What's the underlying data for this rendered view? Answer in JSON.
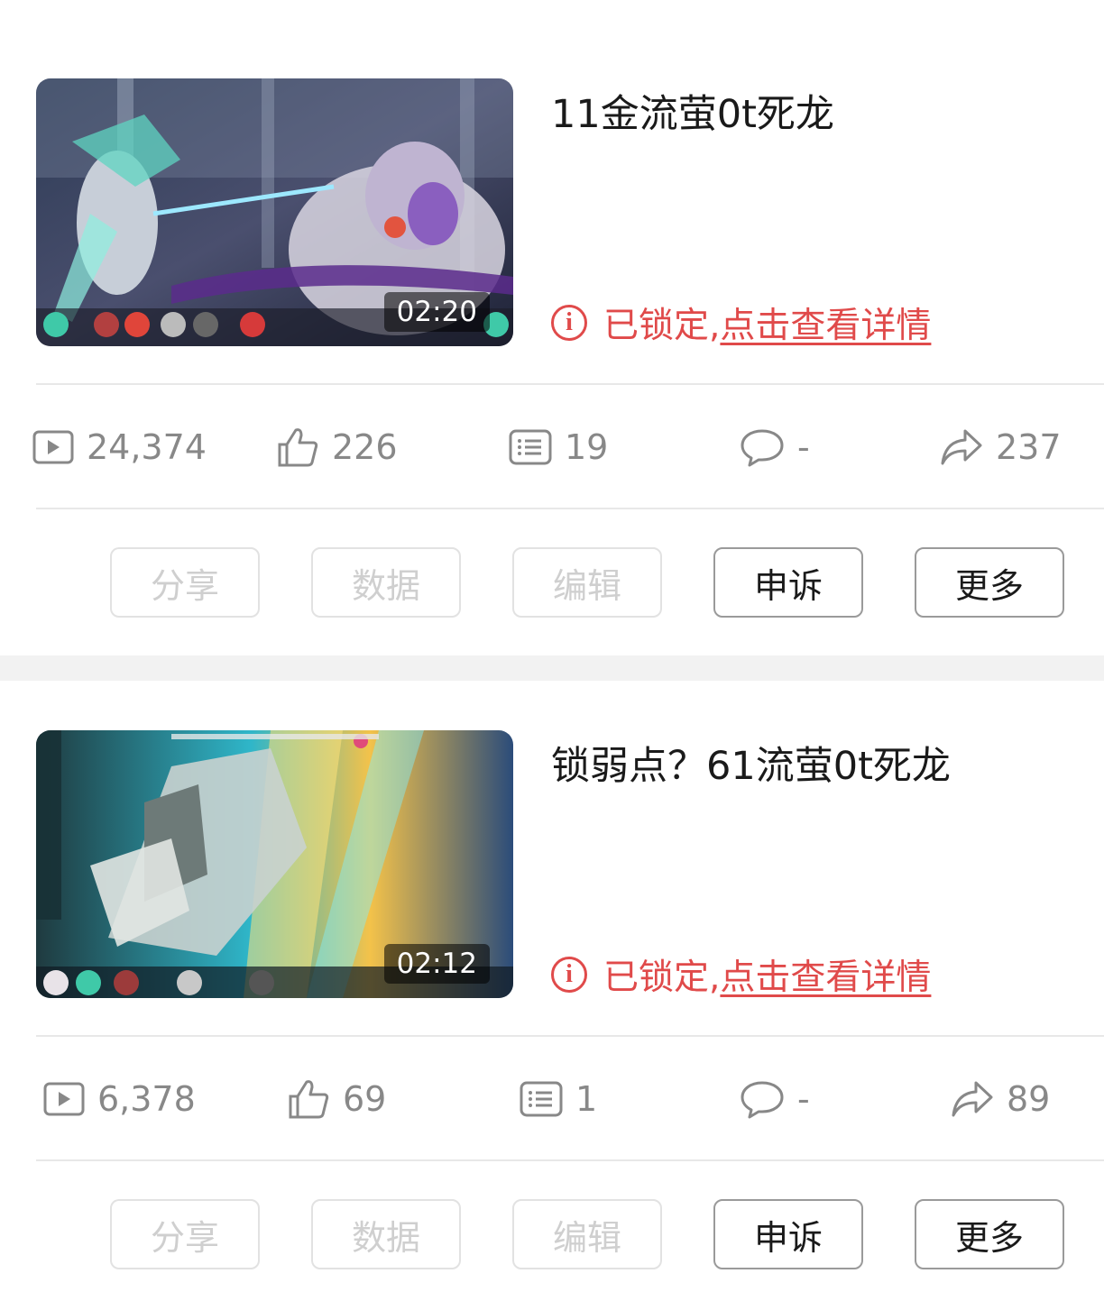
{
  "videos": [
    {
      "title": "11金流萤0t死龙",
      "duration": "02:20",
      "lock_prefix": "已锁定,",
      "lock_link": "点击查看详情",
      "stats": {
        "plays": "24,374",
        "likes": "226",
        "danmaku": "19",
        "comments": "-",
        "shares": "237"
      },
      "buttons": [
        "分享",
        "数据",
        "编辑",
        "申诉",
        "更多"
      ],
      "enabled_buttons": [
        "申诉",
        "更多"
      ]
    },
    {
      "title": "锁弱点？61流萤0t死龙",
      "duration": "02:12",
      "lock_prefix": "已锁定,",
      "lock_link": "点击查看详情",
      "stats": {
        "plays": "6,378",
        "likes": "69",
        "danmaku": "1",
        "comments": "-",
        "shares": "89"
      },
      "buttons": [
        "分享",
        "数据",
        "编辑",
        "申诉",
        "更多"
      ],
      "enabled_buttons": [
        "申诉",
        "更多"
      ]
    }
  ],
  "icons": {
    "play": "play-icon",
    "like": "thumbs-up-icon",
    "danmaku": "danmaku-list-icon",
    "comment": "comment-bubble-icon",
    "share": "share-arrow-icon",
    "lock": "info-circle-icon"
  },
  "colors": {
    "locked_red": "#e04a4a",
    "muted_text": "#888888",
    "disabled_text": "#cfcfcf"
  }
}
